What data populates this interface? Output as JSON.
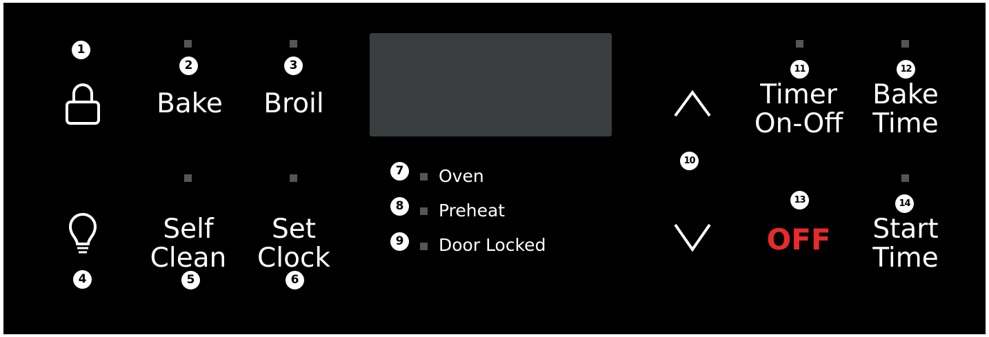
{
  "buttons": {
    "lock": {
      "number": "1",
      "icon": "lock-icon"
    },
    "bake": {
      "number": "2",
      "label": "Bake"
    },
    "broil": {
      "number": "3",
      "label": "Broil"
    },
    "light": {
      "number": "4",
      "icon": "light-bulb-icon"
    },
    "self_clean": {
      "number": "5",
      "label_line1": "Self",
      "label_line2": "Clean"
    },
    "set_clock": {
      "number": "6",
      "label_line1": "Set",
      "label_line2": "Clock"
    },
    "arrows": {
      "number": "10",
      "up_icon": "chevron-up-icon",
      "down_icon": "chevron-down-icon"
    },
    "timer": {
      "number": "11",
      "label_line1": "Timer",
      "label_line2": "On-Off"
    },
    "bake_time": {
      "number": "12",
      "label_line1": "Bake",
      "label_line2": "Time"
    },
    "off": {
      "number": "13",
      "label": "OFF",
      "color": "#e52b2b"
    },
    "start_time": {
      "number": "14",
      "label_line1": "Start",
      "label_line2": "Time"
    }
  },
  "indicators": [
    {
      "number": "7",
      "label": "Oven"
    },
    {
      "number": "8",
      "label": "Preheat"
    },
    {
      "number": "9",
      "label": "Door Locked"
    }
  ],
  "colors": {
    "panel": "#000000",
    "display": "#3a3d40",
    "led": "#555555",
    "off": "#e52b2b"
  }
}
